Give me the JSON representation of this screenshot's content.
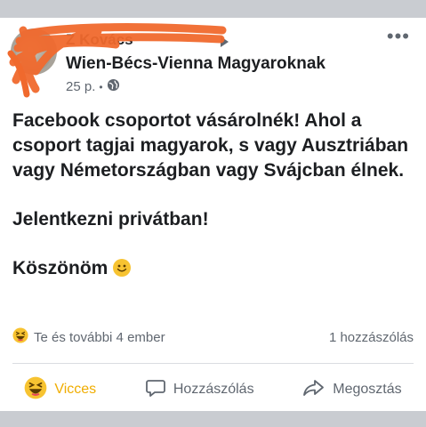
{
  "post": {
    "author_name": "Z Kovács",
    "group_name": "Wien-Bécs-Vienna Magyaroknak",
    "time": "25 p.",
    "separator": "•",
    "more_label": "•••",
    "paragraphs": [
      "Facebook csoportot vásárolnék! Ahol a csoport tagjai magyarok, s vagy Ausztriában vagy Németországban vagy Svájcban élnek.",
      "Jelentkezni privátban!",
      "Köszönöm"
    ]
  },
  "reactions": {
    "summary": "Te és további 4 ember",
    "comments": "1 hozzászólás"
  },
  "actions": {
    "haha_label": "Vicces",
    "comment_label": "Hozzászólás",
    "share_label": "Megosztás"
  },
  "colors": {
    "haha_active": "#f0ad00",
    "text_primary": "#1c1e21",
    "text_secondary": "#606770",
    "redaction": "#f0692d"
  }
}
